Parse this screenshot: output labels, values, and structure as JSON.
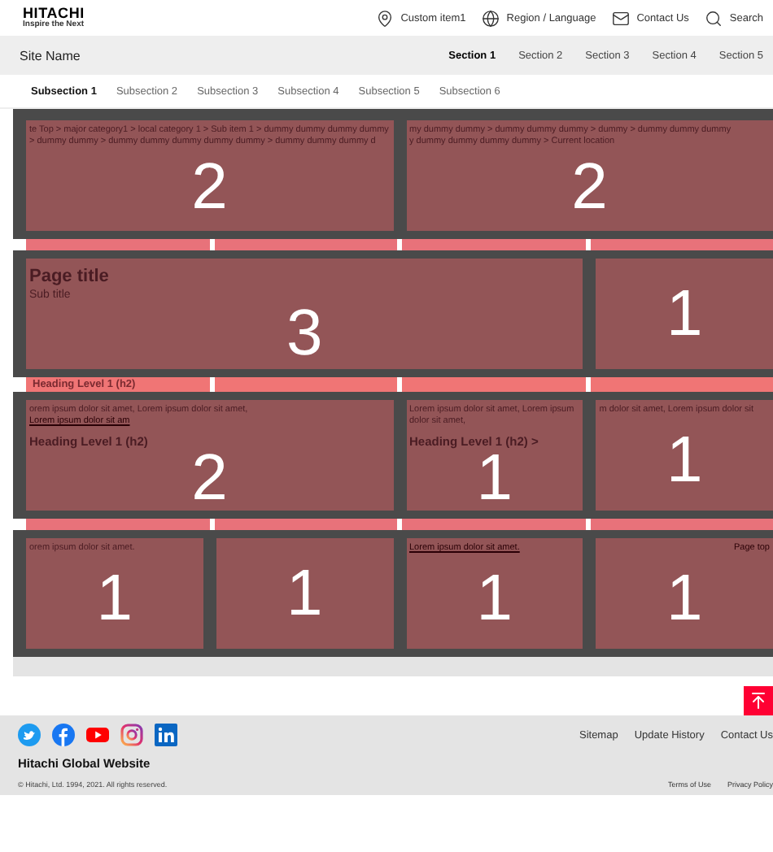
{
  "header": {
    "logo": "HITACHI",
    "tagline": "Inspire the Next",
    "utility": [
      {
        "kind": "pin",
        "label": "Custom item1"
      },
      {
        "kind": "globe",
        "label": "Region / Language"
      },
      {
        "kind": "mail",
        "label": "Contact Us"
      },
      {
        "kind": "search",
        "label": "Search"
      }
    ]
  },
  "nav": {
    "site_name": "Site Name",
    "sections": [
      {
        "label": "Section 1",
        "selected": true
      },
      {
        "label": "Section 2",
        "selected": false
      },
      {
        "label": "Section 3",
        "selected": false
      },
      {
        "label": "Section 4",
        "selected": false
      },
      {
        "label": "Section 5",
        "selected": false
      }
    ]
  },
  "subnav": [
    {
      "label": "Subsection 1",
      "selected": true
    },
    {
      "label": "Subsection 2",
      "selected": false
    },
    {
      "label": "Subsection 3",
      "selected": false
    },
    {
      "label": "Subsection 4",
      "selected": false
    },
    {
      "label": "Subsection 5",
      "selected": false
    },
    {
      "label": "Subsection 6",
      "selected": false
    }
  ],
  "grid": [
    {
      "kind": "tiles",
      "tiles": [
        {
          "span": "2",
          "lines": [
            {
              "kind": "crumb",
              "text": "te Top > major category1 > local category 1 > Sub item 1 > dummy dummy dummy dummy"
            },
            {
              "kind": "crumb",
              "text": "> dummy dummy > dummy dummy dummy dummy dummy > dummy dummy dummy d"
            }
          ]
        },
        {
          "span": "2",
          "lines": [
            {
              "kind": "crumb",
              "text": "my dummy dummy > dummy dummy dummy > dummy > dummy dummy dummy"
            },
            {
              "kind": "crumb",
              "text": "y dummy dummy dummy dummy > Current location"
            }
          ]
        }
      ]
    },
    {
      "kind": "strip"
    },
    {
      "kind": "tiles",
      "tiles": [
        {
          "span": "3",
          "lines": [
            {
              "kind": "title",
              "text": "Page title"
            },
            {
              "kind": "subtitle",
              "text": "Sub title"
            }
          ]
        },
        {
          "span": "1"
        }
      ]
    },
    {
      "kind": "strip",
      "text": "Heading Level 1 (h2)"
    },
    {
      "kind": "tiles",
      "tiles": [
        {
          "span": "2",
          "lines": [
            {
              "kind": "text",
              "text": "orem ipsum dolor sit amet, Lorem ipsum dolor sit amet,"
            },
            {
              "kind": "link",
              "text": "Lorem ipsum dolor sit am"
            },
            {
              "kind": "heading",
              "text": "Heading Level 1 (h2)"
            }
          ]
        },
        {
          "span": "1",
          "lines": [
            {
              "kind": "text",
              "text": "Lorem ipsum dolor sit amet, Lorem ipsum dolor sit amet,"
            },
            {
              "kind": "heading",
              "text": "Heading Level 1 (h2) >"
            }
          ]
        },
        {
          "span": "1",
          "lines": [
            {
              "kind": "text",
              "text": "m dolor sit amet, Lorem ipsum dolor sit"
            }
          ]
        }
      ]
    },
    {
      "kind": "strip"
    },
    {
      "kind": "tiles",
      "tiles": [
        {
          "span": "1",
          "lines": [
            {
              "kind": "text",
              "text": "orem ipsum dolor sit amet."
            }
          ]
        },
        {
          "span": "1"
        },
        {
          "span": "1",
          "lines": [
            {
              "kind": "link",
              "text": "Lorem ipsum dolor sit amet."
            }
          ]
        },
        {
          "span": "1",
          "lines": [
            {
              "kind": "pagetop",
              "text": "Page top"
            }
          ]
        }
      ]
    }
  ],
  "footer": {
    "links": [
      "Sitemap",
      "Update History",
      "Contact Us"
    ],
    "site": "Hitachi Global Website",
    "copyright": "© Hitachi, Ltd. 1994, 2021. All rights reserved.",
    "legal": [
      "Terms of Use",
      "Privacy Policy"
    ]
  }
}
